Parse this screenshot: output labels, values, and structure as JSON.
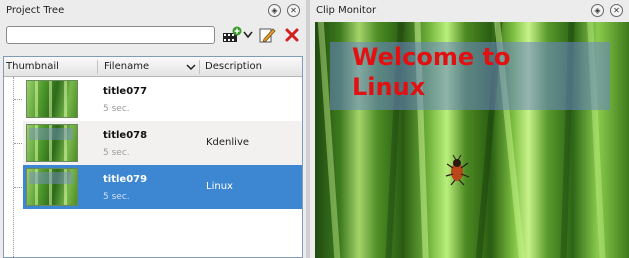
{
  "project_tree": {
    "title": "Project Tree",
    "search_value": "",
    "columns": {
      "thumbnail": "Thumbnail",
      "filename": "Filename",
      "description": "Description"
    },
    "items": [
      {
        "title": "title077",
        "duration": "5 sec.",
        "description": ""
      },
      {
        "title": "title078",
        "duration": "5 sec.",
        "description": "Kdenlive"
      },
      {
        "title": "title079",
        "duration": "5 sec.",
        "description": "Linux",
        "selected": true
      }
    ],
    "toolbar_icons": [
      "add-clip-icon",
      "dropdown-arrow-icon",
      "edit-clip-icon",
      "delete-clip-icon"
    ]
  },
  "clip_monitor": {
    "title": "Clip Monitor",
    "overlay_line1": "Welcome to",
    "overlay_line2": "Linux"
  },
  "colors": {
    "selection": "#3d86d1",
    "overlay_text": "#e21010",
    "delete_icon": "#d22020"
  }
}
